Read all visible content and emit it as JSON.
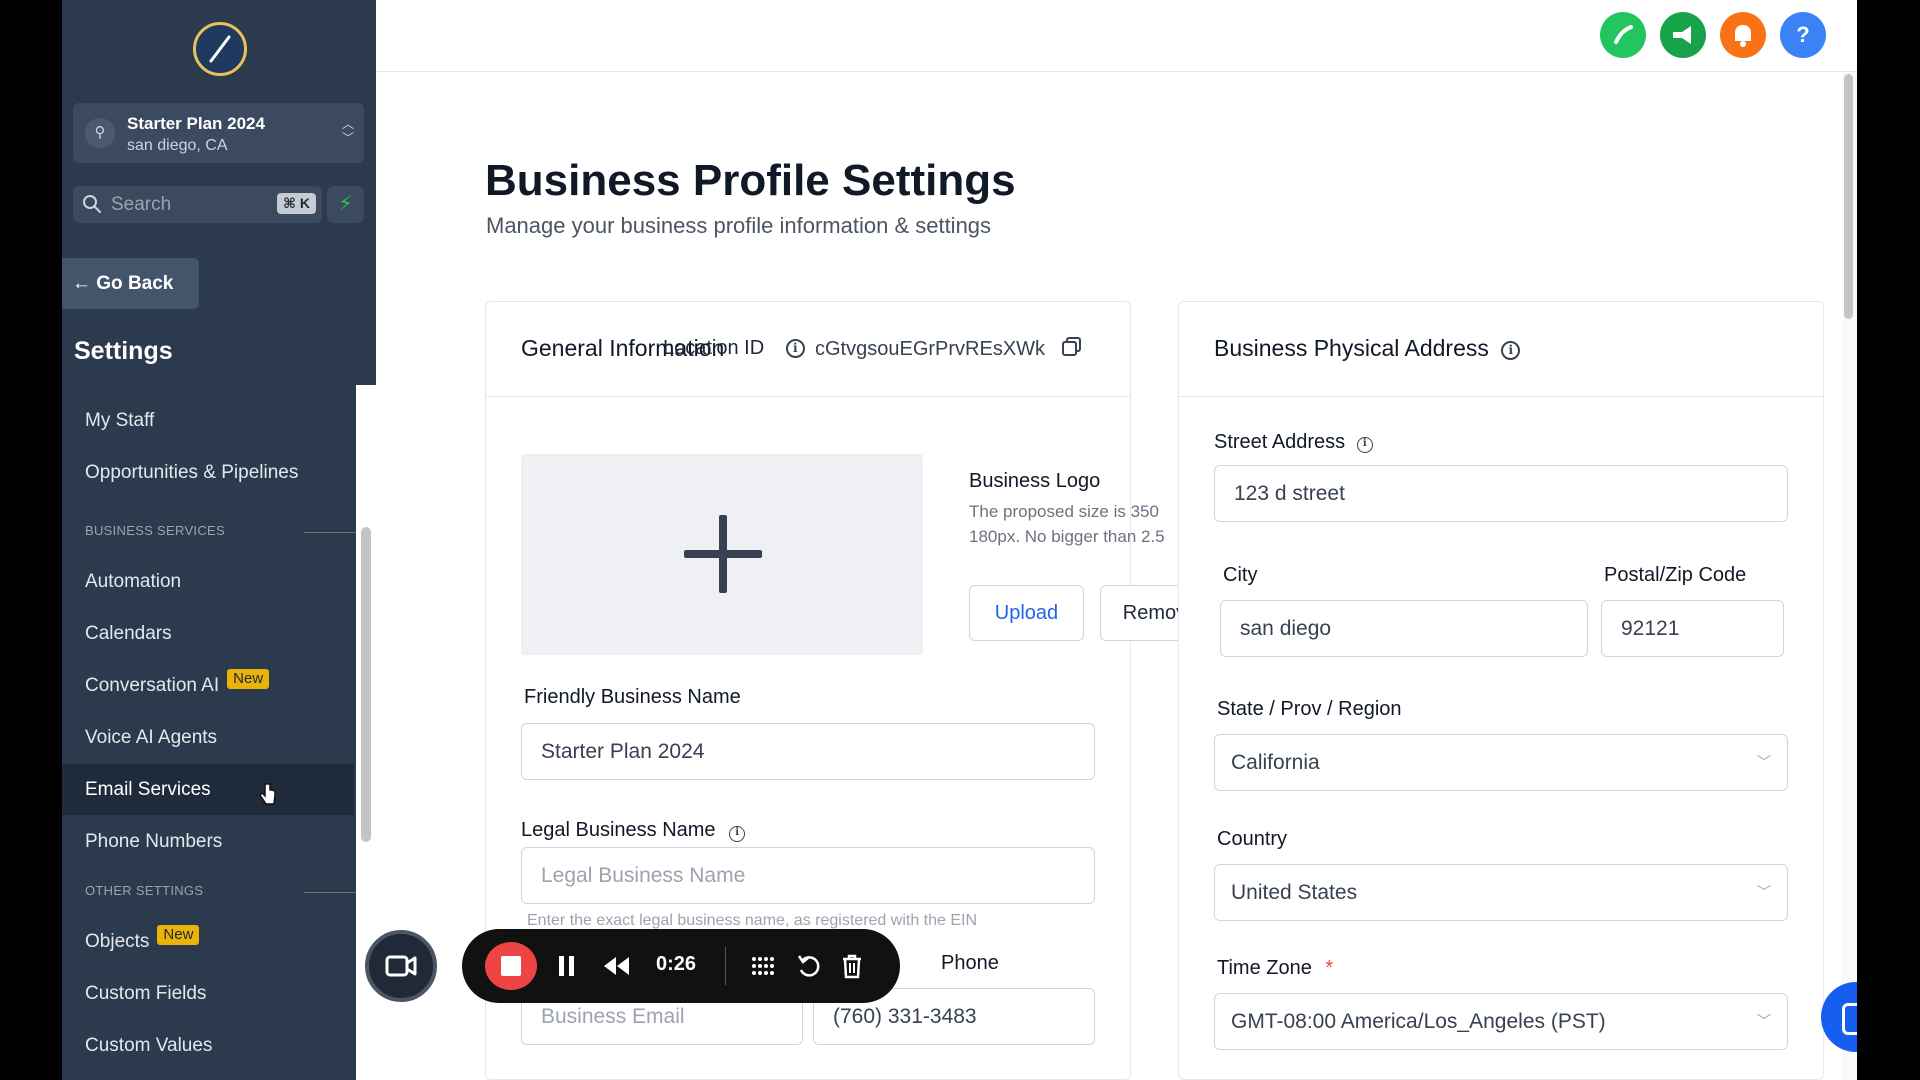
{
  "sidebar": {
    "account": {
      "name": "Starter Plan 2024",
      "location": "san diego, CA"
    },
    "search": {
      "placeholder": "Search",
      "shortcut": "⌘ K"
    },
    "go_back": "Go Back",
    "heading": "Settings",
    "items": [
      {
        "label": "My Staff"
      },
      {
        "label": "Opportunities & Pipelines"
      },
      {
        "label": "Automation"
      },
      {
        "label": "Calendars"
      },
      {
        "label": "Conversation AI",
        "badge": "New"
      },
      {
        "label": "Voice AI Agents"
      },
      {
        "label": "Email Services"
      },
      {
        "label": "Phone Numbers"
      },
      {
        "label": "Objects",
        "badge": "New"
      },
      {
        "label": "Custom Fields"
      },
      {
        "label": "Custom Values"
      }
    ],
    "sections": {
      "business_services": "BUSINESS SERVICES",
      "other_settings": "OTHER SETTINGS"
    },
    "active_item": "Email Services"
  },
  "topbar": {
    "icons": [
      "phone-icon",
      "megaphone-icon",
      "bell-icon",
      "help-icon"
    ],
    "colors": {
      "phone": "#22c55e",
      "megaphone": "#16a34a",
      "bell": "#f97316",
      "help": "#3b82f6"
    },
    "help_label": "?"
  },
  "page": {
    "title": "Business Profile Settings",
    "subtitle": "Manage your business profile information & settings"
  },
  "general": {
    "title": "General Information",
    "location_id_label": "Location ID",
    "location_id_value": "cGtvgsouEGrPrvREsXWk",
    "logo_title": "Business Logo",
    "logo_desc_1": "The proposed size is 350",
    "logo_desc_2": "180px. No bigger than 2.5",
    "upload": "Upload",
    "remove": "Remove",
    "friendly_label": "Friendly Business Name",
    "friendly_value": "Starter Plan 2024",
    "legal_label": "Legal Business Name",
    "legal_placeholder": "Legal Business Name",
    "legal_help": "Enter the exact legal business name, as registered with the EIN",
    "email_placeholder": "Business Email",
    "phone_label": "Phone",
    "phone_value": "(760) 331-3483"
  },
  "address": {
    "title": "Business Physical Address",
    "street_label": "Street Address",
    "street_value": "123 d street",
    "city_label": "City",
    "city_value": "san diego",
    "zip_label": "Postal/Zip Code",
    "zip_value": "92121",
    "state_label": "State / Prov / Region",
    "state_value": "California",
    "country_label": "Country",
    "country_value": "United States",
    "tz_label": "Time Zone",
    "tz_required": "*",
    "tz_value": "GMT-08:00 America/Los_Angeles (PST)"
  },
  "recorder": {
    "time": "0:26"
  }
}
